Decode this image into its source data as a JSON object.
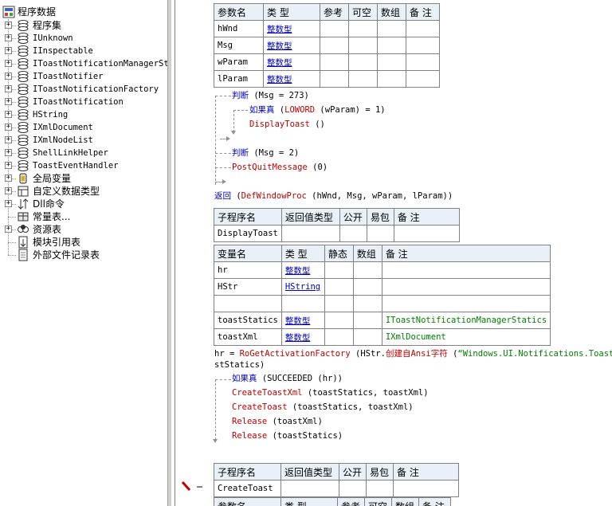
{
  "tree": {
    "root": "程序数据",
    "items": [
      {
        "label": "程序集",
        "icon": "assembly-icon",
        "expander": "+",
        "mono": false
      },
      {
        "label": "IUnknown",
        "icon": "class-icon",
        "expander": "+",
        "mono": true
      },
      {
        "label": "IInspectable",
        "icon": "class-icon",
        "expander": "+",
        "mono": true
      },
      {
        "label": "IToastNotificationManagerSta",
        "icon": "class-icon",
        "expander": "+",
        "mono": true
      },
      {
        "label": "IToastNotifier",
        "icon": "class-icon",
        "expander": "+",
        "mono": true
      },
      {
        "label": "IToastNotificationFactory",
        "icon": "class-icon",
        "expander": "+",
        "mono": true
      },
      {
        "label": "IToastNotification",
        "icon": "class-icon",
        "expander": "+",
        "mono": true
      },
      {
        "label": "HString",
        "icon": "class-icon",
        "expander": "+",
        "mono": true
      },
      {
        "label": "IXmlDocument",
        "icon": "class-icon",
        "expander": "+",
        "mono": true
      },
      {
        "label": "IXmlNodeList",
        "icon": "class-icon",
        "expander": "+",
        "mono": true
      },
      {
        "label": "ShellLinkHelper",
        "icon": "class-icon",
        "expander": "+",
        "mono": true
      },
      {
        "label": "ToastEventHandler",
        "icon": "class-icon",
        "expander": "+",
        "mono": true
      },
      {
        "label": "全局变量",
        "icon": "global-var-icon",
        "expander": "+",
        "mono": false
      },
      {
        "label": "自定义数据类型",
        "icon": "datatype-icon",
        "expander": "+",
        "mono": false
      },
      {
        "label": "Dll命令",
        "icon": "dll-icon",
        "expander": "+",
        "mono": false
      },
      {
        "label": "常量表...",
        "icon": "constant-icon",
        "expander": "",
        "mono": false
      },
      {
        "label": "资源表",
        "icon": "resource-icon",
        "expander": "+",
        "mono": false
      },
      {
        "label": "模块引用表",
        "icon": "module-icon",
        "expander": "",
        "mono": false
      },
      {
        "label": "外部文件记录表",
        "icon": "file-icon",
        "expander": "",
        "mono": false
      }
    ]
  },
  "params_table": {
    "headers": [
      "参数名",
      "类 型",
      "参考",
      "可空",
      "数组",
      "备 注"
    ],
    "rows": [
      [
        "hWnd",
        "整数型"
      ],
      [
        "Msg",
        "整数型"
      ],
      [
        "wParam",
        "整数型"
      ],
      [
        "lParam",
        "整数型"
      ]
    ]
  },
  "code1": {
    "judge1": "判断",
    "judge1_cond": "(Msg = 273)",
    "if_true": "如果真",
    "if_true_cond_fn": "LOWORD",
    "if_true_cond_rest": "(wParam) = 1)",
    "if_true_cond_open": "(",
    "display_toast": "DisplayToast",
    "display_toast_args": "()",
    "judge2": "判断",
    "judge2_cond": "(Msg = 2)",
    "post_quit": "PostQuitMessage",
    "post_quit_args": "(0)",
    "return_kw": "返回",
    "return_open": "(",
    "def_window_proc": "DefWindowProc",
    "return_args": "(hWnd, Msg, wParam, lParam))"
  },
  "sub1_table": {
    "headers": [
      "子程序名",
      "返回值类型",
      "公开",
      "易包",
      "备 注"
    ],
    "name": "DisplayToast"
  },
  "vars_table": {
    "headers": [
      "变量名",
      "类 型",
      "静态",
      "数组",
      "备 注"
    ],
    "rows": [
      {
        "name": "hr",
        "type": "整数型",
        "note": ""
      },
      {
        "name": "HStr",
        "type": "HString",
        "note": ""
      },
      {
        "name": "",
        "type": "",
        "note": ""
      },
      {
        "name": "toastStatics",
        "type": "整数型",
        "note": "IToastNotificationManagerStatics"
      },
      {
        "name": "toastXml",
        "type": "整数型",
        "note": "IXmlDocument"
      }
    ]
  },
  "code2": {
    "assign_lhs": "hr = ",
    "ro_get": "RoGetActivationFactory",
    "hstr_open": "(HStr.",
    "create_ansi": "创建自Ansi字符",
    "str_open": "(",
    "string_literal": "“Windows.UI.Notifications.Toast",
    "cont": "stStatics)",
    "if_true": "如果真",
    "succeeded": "(SUCCEEDED",
    "succeeded_args": "(hr))",
    "calls": [
      {
        "fn": "CreateToastXml",
        "args": "(toastStatics, toastXml)"
      },
      {
        "fn": "CreateToast",
        "args": "(toastStatics, toastXml)"
      },
      {
        "fn": "Release",
        "args": "(toastXml)"
      },
      {
        "fn": "Release",
        "args": "(toastStatics)"
      }
    ]
  },
  "sub2_table": {
    "headers": [
      "子程序名",
      "返回值类型",
      "公开",
      "易包",
      "备 注"
    ],
    "name": "CreateToast",
    "next_headers": [
      "参数名",
      "类 型",
      "参考",
      "可空",
      "数组",
      "备 注"
    ]
  },
  "colors": {
    "keyword": "#0000c0",
    "function": "#c00000",
    "type": "#0000c0",
    "note": "#008000",
    "header_bg": "#eaf0f8"
  }
}
